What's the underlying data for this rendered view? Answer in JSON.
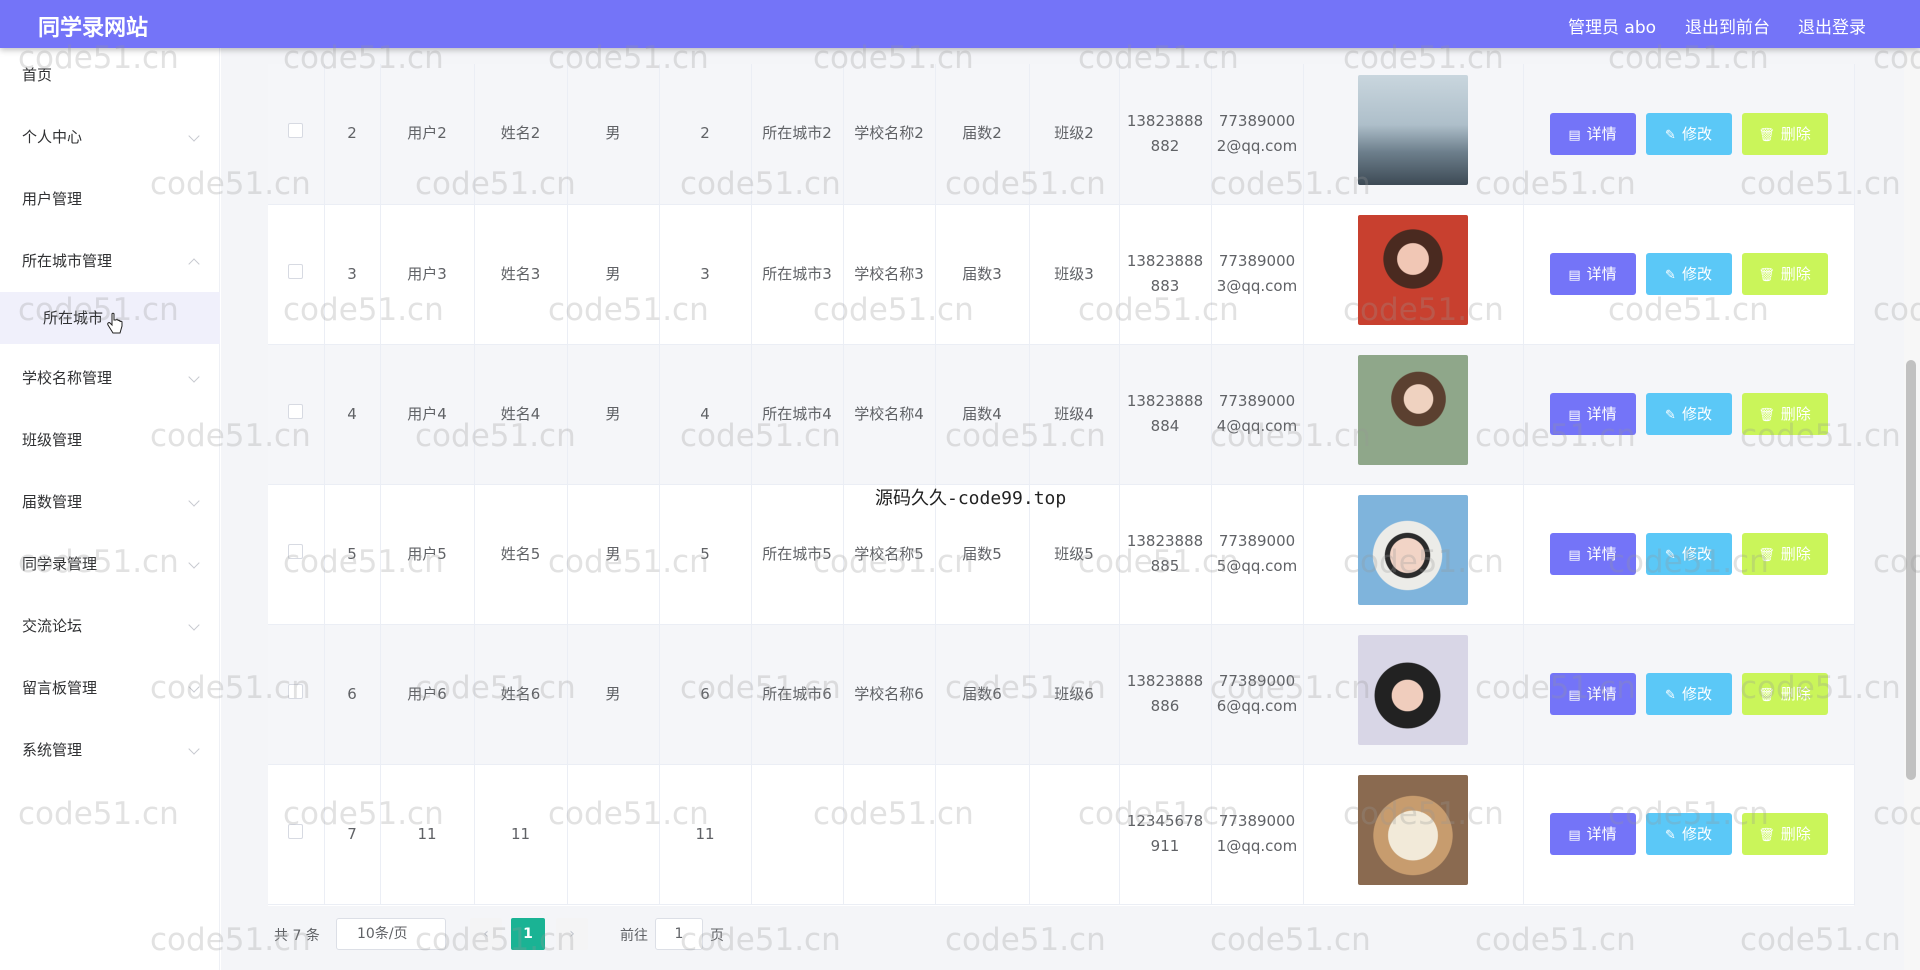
{
  "header": {
    "title": "同学录网站",
    "user": "管理员 abo",
    "frontend_link": "退出到前台",
    "logout_link": "退出登录"
  },
  "sidebar": {
    "items": [
      {
        "label": "首页"
      },
      {
        "label": "个人中心"
      },
      {
        "label": "用户管理"
      },
      {
        "label": "所在城市管理"
      },
      {
        "label": "学校名称管理"
      },
      {
        "label": "班级管理"
      },
      {
        "label": "届数管理"
      },
      {
        "label": "同学录管理"
      },
      {
        "label": "交流论坛"
      },
      {
        "label": "留言板管理"
      },
      {
        "label": "系统管理"
      }
    ],
    "active_sub": "所在城市"
  },
  "table": {
    "rows": [
      {
        "index": "2",
        "username": "用户2",
        "name": "姓名2",
        "gender": "男",
        "cls_no": "2",
        "city": "所在城市2",
        "school": "学校名称2",
        "grade": "届数2",
        "class": "班级2",
        "phone": "13823888882",
        "email": "773890002@qq.com"
      },
      {
        "index": "3",
        "username": "用户3",
        "name": "姓名3",
        "gender": "男",
        "cls_no": "3",
        "city": "所在城市3",
        "school": "学校名称3",
        "grade": "届数3",
        "class": "班级3",
        "phone": "13823888883",
        "email": "773890003@qq.com"
      },
      {
        "index": "4",
        "username": "用户4",
        "name": "姓名4",
        "gender": "男",
        "cls_no": "4",
        "city": "所在城市4",
        "school": "学校名称4",
        "grade": "届数4",
        "class": "班级4",
        "phone": "13823888884",
        "email": "773890004@qq.com"
      },
      {
        "index": "5",
        "username": "用户5",
        "name": "姓名5",
        "gender": "男",
        "cls_no": "5",
        "city": "所在城市5",
        "school": "学校名称5",
        "grade": "届数5",
        "class": "班级5",
        "phone": "13823888885",
        "email": "773890005@qq.com"
      },
      {
        "index": "6",
        "username": "用户6",
        "name": "姓名6",
        "gender": "男",
        "cls_no": "6",
        "city": "所在城市6",
        "school": "学校名称6",
        "grade": "届数6",
        "class": "班级6",
        "phone": "13823888886",
        "email": "773890006@qq.com"
      },
      {
        "index": "7",
        "username": "11",
        "name": "11",
        "gender": "",
        "cls_no": "11",
        "city": "",
        "school": "",
        "grade": "",
        "class": "",
        "phone": "12345678911",
        "email": "773890001@qq.com"
      }
    ],
    "actions": {
      "detail": "详情",
      "edit": "修改",
      "delete": "删除"
    }
  },
  "pagination": {
    "total": "共 7 条",
    "page_size": "10条/页",
    "current_page": "1",
    "goto_label": "前往",
    "goto_value": "1",
    "page_suffix": "页"
  },
  "watermarks": {
    "repeat": "code51.cn",
    "center": "源码久久-code99.top"
  },
  "colors": {
    "header": "#7474f8",
    "detail_button": "#7474f8",
    "edit_button": "#5bc8f7",
    "delete_button": "#caf55a",
    "page_active": "#1ab394"
  }
}
